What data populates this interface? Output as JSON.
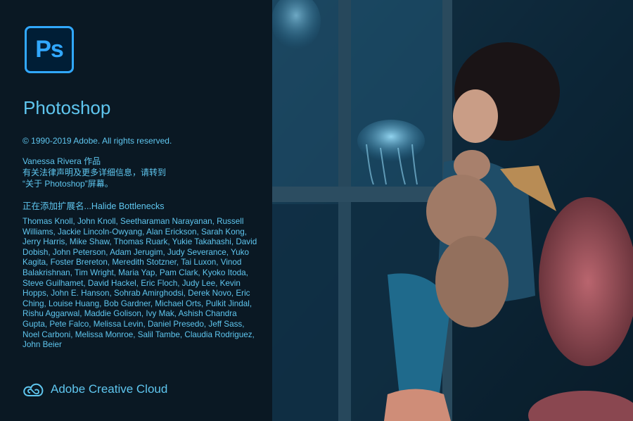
{
  "app": {
    "logo_text": "Ps",
    "name": "Photoshop"
  },
  "copyright": "© 1990-2019 Adobe. All rights reserved.",
  "artwork_credit": {
    "line1": "Vanessa Rivera 作品",
    "line2": "有关法律声明及更多详细信息，请转到",
    "line3": "“关于 Photoshop”屏幕。"
  },
  "loading_status": "正在添加扩展名...Halide Bottlenecks",
  "credits": "Thomas Knoll, John Knoll, Seetharaman Narayanan, Russell Williams, Jackie Lincoln-Owyang, Alan Erickson, Sarah Kong, Jerry Harris, Mike Shaw, Thomas Ruark, Yukie Takahashi, David Dobish, John Peterson, Adam Jerugim, Judy Severance, Yuko Kagita, Foster Brereton, Meredith Stotzner, Tai Luxon, Vinod Balakrishnan, Tim Wright, Maria Yap, Pam Clark, Kyoko Itoda, Steve Guilhamet, David Hackel, Eric Floch, Judy Lee, Kevin Hopps, John E. Hanson, Sohrab Amirghodsi, Derek Novo, Eric Ching, Louise Huang, Bob Gardner, Michael Orts, Pulkit Jindal, Rishu Aggarwal, Maddie Golison, Ivy Mak, Ashish Chandra Gupta, Pete Falco, Melissa Levin, Daniel Presedo, Jeff Sass, Noel Carboni, Melissa Monroe, Salil Tambe, Claudia Rodriguez, John Beier",
  "brand": {
    "label": "Adobe Creative Cloud",
    "icon": "creative-cloud-icon"
  },
  "colors": {
    "panel_bg": "#0a1823",
    "text": "#5fc6ef",
    "logo_border": "#31a8ff",
    "logo_bg": "#001e36"
  }
}
